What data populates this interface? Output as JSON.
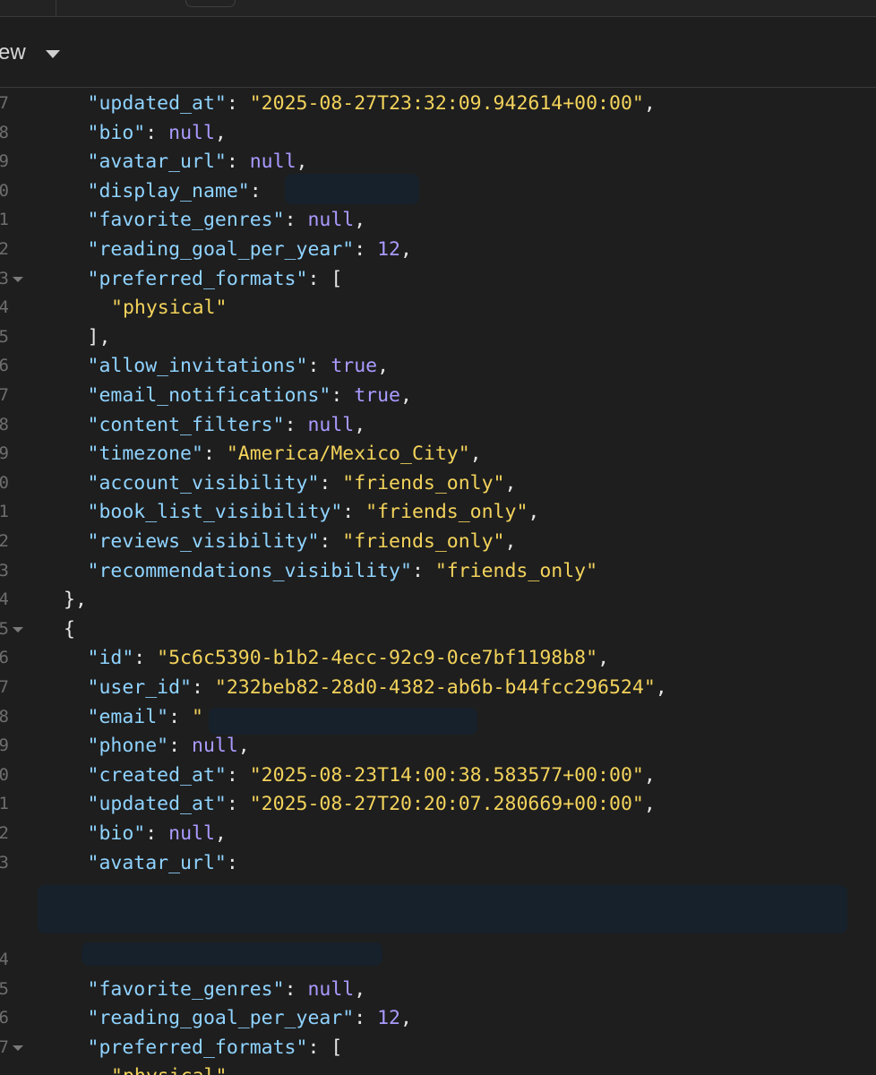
{
  "toolbar": {
    "view_label": "ew"
  },
  "lines": [
    {
      "ln": "7",
      "fold": false,
      "indent": 4,
      "tokens": [
        [
          "k",
          "\"updated_at\""
        ],
        [
          "p",
          ": "
        ],
        [
          "s",
          "\"2025-08-27T23:32:09.942614+00:00\""
        ],
        [
          "p",
          ","
        ]
      ]
    },
    {
      "ln": "8",
      "fold": false,
      "indent": 4,
      "tokens": [
        [
          "k",
          "\"bio\""
        ],
        [
          "p",
          ": "
        ],
        [
          "n",
          "null"
        ],
        [
          "p",
          ","
        ]
      ]
    },
    {
      "ln": "9",
      "fold": false,
      "indent": 4,
      "tokens": [
        [
          "k",
          "\"avatar_url\""
        ],
        [
          "p",
          ": "
        ],
        [
          "n",
          "null"
        ],
        [
          "p",
          ","
        ]
      ]
    },
    {
      "ln": "0",
      "fold": false,
      "indent": 4,
      "tokens": [
        [
          "k",
          "\"display_name\""
        ],
        [
          "p",
          ": "
        ]
      ]
    },
    {
      "ln": "1",
      "fold": false,
      "indent": 4,
      "tokens": [
        [
          "k",
          "\"favorite_genres\""
        ],
        [
          "p",
          ": "
        ],
        [
          "n",
          "null"
        ],
        [
          "p",
          ","
        ]
      ]
    },
    {
      "ln": "2",
      "fold": false,
      "indent": 4,
      "tokens": [
        [
          "k",
          "\"reading_goal_per_year\""
        ],
        [
          "p",
          ": "
        ],
        [
          "n",
          "12"
        ],
        [
          "p",
          ","
        ]
      ]
    },
    {
      "ln": "3",
      "fold": true,
      "indent": 4,
      "tokens": [
        [
          "k",
          "\"preferred_formats\""
        ],
        [
          "p",
          ": ["
        ]
      ]
    },
    {
      "ln": "4",
      "fold": false,
      "indent": 5,
      "tokens": [
        [
          "s",
          "\"physical\""
        ]
      ]
    },
    {
      "ln": "5",
      "fold": false,
      "indent": 4,
      "tokens": [
        [
          "p",
          "],"
        ]
      ]
    },
    {
      "ln": "6",
      "fold": false,
      "indent": 4,
      "tokens": [
        [
          "k",
          "\"allow_invitations\""
        ],
        [
          "p",
          ": "
        ],
        [
          "n",
          "true"
        ],
        [
          "p",
          ","
        ]
      ]
    },
    {
      "ln": "7",
      "fold": false,
      "indent": 4,
      "tokens": [
        [
          "k",
          "\"email_notifications\""
        ],
        [
          "p",
          ": "
        ],
        [
          "n",
          "true"
        ],
        [
          "p",
          ","
        ]
      ]
    },
    {
      "ln": "8",
      "fold": false,
      "indent": 4,
      "tokens": [
        [
          "k",
          "\"content_filters\""
        ],
        [
          "p",
          ": "
        ],
        [
          "n",
          "null"
        ],
        [
          "p",
          ","
        ]
      ]
    },
    {
      "ln": "9",
      "fold": false,
      "indent": 4,
      "tokens": [
        [
          "k",
          "\"timezone\""
        ],
        [
          "p",
          ": "
        ],
        [
          "s",
          "\"America/Mexico_City\""
        ],
        [
          "p",
          ","
        ]
      ]
    },
    {
      "ln": "0",
      "fold": false,
      "indent": 4,
      "tokens": [
        [
          "k",
          "\"account_visibility\""
        ],
        [
          "p",
          ": "
        ],
        [
          "s",
          "\"friends_only\""
        ],
        [
          "p",
          ","
        ]
      ]
    },
    {
      "ln": "1",
      "fold": false,
      "indent": 4,
      "tokens": [
        [
          "k",
          "\"book_list_visibility\""
        ],
        [
          "p",
          ": "
        ],
        [
          "s",
          "\"friends_only\""
        ],
        [
          "p",
          ","
        ]
      ]
    },
    {
      "ln": "2",
      "fold": false,
      "indent": 4,
      "tokens": [
        [
          "k",
          "\"reviews_visibility\""
        ],
        [
          "p",
          ": "
        ],
        [
          "s",
          "\"friends_only\""
        ],
        [
          "p",
          ","
        ]
      ]
    },
    {
      "ln": "3",
      "fold": false,
      "indent": 4,
      "tokens": [
        [
          "k",
          "\"recommendations_visibility\""
        ],
        [
          "p",
          ": "
        ],
        [
          "s",
          "\"friends_only\""
        ]
      ]
    },
    {
      "ln": "4",
      "fold": false,
      "indent": 3,
      "tokens": [
        [
          "p",
          "},"
        ]
      ]
    },
    {
      "ln": "5",
      "fold": true,
      "indent": 3,
      "tokens": [
        [
          "p",
          "{"
        ]
      ]
    },
    {
      "ln": "6",
      "fold": false,
      "indent": 4,
      "tokens": [
        [
          "k",
          "\"id\""
        ],
        [
          "p",
          ": "
        ],
        [
          "s",
          "\"5c6c5390-b1b2-4ecc-92c9-0ce7bf1198b8\""
        ],
        [
          "p",
          ","
        ]
      ]
    },
    {
      "ln": "7",
      "fold": false,
      "indent": 4,
      "tokens": [
        [
          "k",
          "\"user_id\""
        ],
        [
          "p",
          ": "
        ],
        [
          "s",
          "\"232beb82-28d0-4382-ab6b-b44fcc296524\""
        ],
        [
          "p",
          ","
        ]
      ]
    },
    {
      "ln": "8",
      "fold": false,
      "indent": 4,
      "tokens": [
        [
          "k",
          "\"email\""
        ],
        [
          "p",
          ": "
        ],
        [
          "s",
          "\""
        ]
      ]
    },
    {
      "ln": "9",
      "fold": false,
      "indent": 4,
      "tokens": [
        [
          "k",
          "\"phone\""
        ],
        [
          "p",
          ": "
        ],
        [
          "n",
          "null"
        ],
        [
          "p",
          ","
        ]
      ]
    },
    {
      "ln": "0",
      "fold": false,
      "indent": 4,
      "tokens": [
        [
          "k",
          "\"created_at\""
        ],
        [
          "p",
          ": "
        ],
        [
          "s",
          "\"2025-08-23T14:00:38.583577+00:00\""
        ],
        [
          "p",
          ","
        ]
      ]
    },
    {
      "ln": "1",
      "fold": false,
      "indent": 4,
      "tokens": [
        [
          "k",
          "\"updated_at\""
        ],
        [
          "p",
          ": "
        ],
        [
          "s",
          "\"2025-08-27T20:20:07.280669+00:00\""
        ],
        [
          "p",
          ","
        ]
      ]
    },
    {
      "ln": "2",
      "fold": false,
      "indent": 4,
      "tokens": [
        [
          "k",
          "\"bio\""
        ],
        [
          "p",
          ": "
        ],
        [
          "n",
          "null"
        ],
        [
          "p",
          ","
        ]
      ]
    },
    {
      "ln": "3",
      "fold": false,
      "indent": 4,
      "tokens": [
        [
          "k",
          "\"avatar_url\""
        ],
        [
          "p",
          ":"
        ]
      ]
    }
  ],
  "lines_after": [
    {
      "ln": "4",
      "fold": false,
      "indent": 4,
      "tokens": []
    },
    {
      "ln": "5",
      "fold": false,
      "indent": 4,
      "tokens": [
        [
          "k",
          "\"favorite_genres\""
        ],
        [
          "p",
          ": "
        ],
        [
          "n",
          "null"
        ],
        [
          "p",
          ","
        ]
      ]
    },
    {
      "ln": "6",
      "fold": false,
      "indent": 4,
      "tokens": [
        [
          "k",
          "\"reading_goal_per_year\""
        ],
        [
          "p",
          ": "
        ],
        [
          "n",
          "12"
        ],
        [
          "p",
          ","
        ]
      ]
    },
    {
      "ln": "7",
      "fold": true,
      "indent": 4,
      "tokens": [
        [
          "k",
          "\"preferred_formats\""
        ],
        [
          "p",
          ": ["
        ]
      ]
    },
    {
      "ln": "",
      "fold": false,
      "indent": 5,
      "tokens": [
        [
          "s",
          "\"physical\""
        ]
      ]
    }
  ]
}
